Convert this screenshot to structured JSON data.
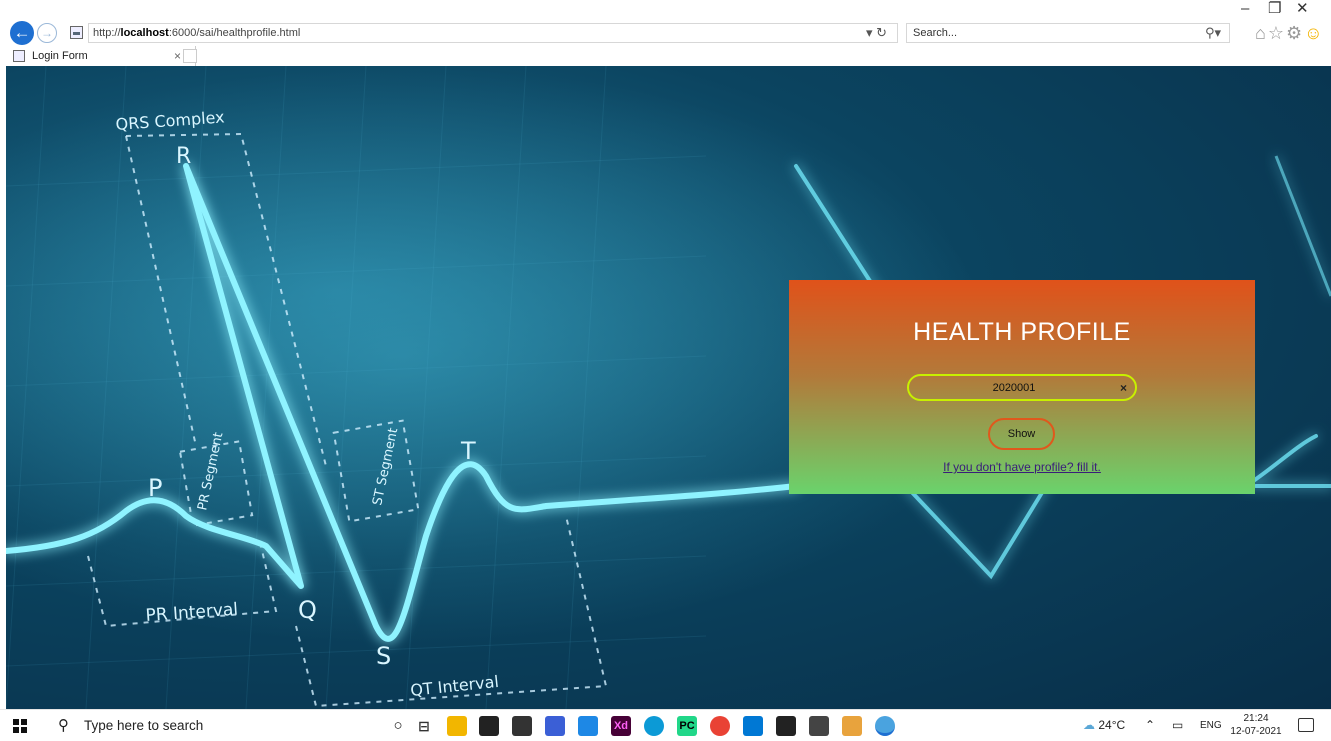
{
  "browser": {
    "url_prefix": "http://",
    "url_host": "localhost",
    "url_rest": ":6000/sai/healthprofile.html",
    "refresh_label": "▾ ↻",
    "search_placeholder": "Search...",
    "tab_title": "Login Form"
  },
  "background": {
    "qrs_complex": "QRS Complex",
    "label_r": "R",
    "label_p": "P",
    "label_q": "Q",
    "label_s": "S",
    "label_t": "T",
    "pr_segment": "PR Segment",
    "st_segment": "ST Segment",
    "pr_interval": "PR Interval",
    "qt_interval": "QT Interval"
  },
  "panel": {
    "title": "HEALTH PROFILE",
    "input_value": "2020001",
    "clear_glyph": "×",
    "show_label": "Show",
    "fill_link": "If you don't have profile? fill it."
  },
  "taskbar": {
    "search_placeholder": "Type here to search",
    "weather": "24°C",
    "lang": "ENG",
    "time": "21:24",
    "date": "12-07-2021"
  },
  "colors": {
    "panel_top": "#e0521a",
    "panel_bottom": "#6ad36c",
    "input_border": "#c8f000",
    "button_border": "#e0581c",
    "link": "#3a1d7a"
  }
}
